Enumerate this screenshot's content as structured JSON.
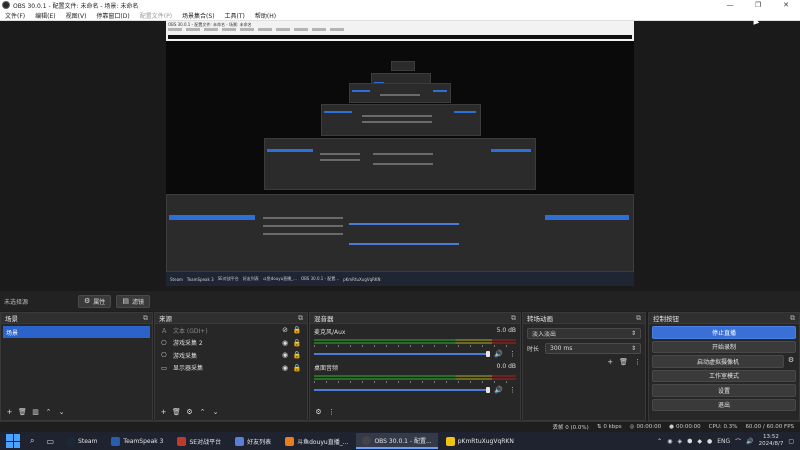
{
  "window": {
    "title": "OBS 30.0.1 - 配置文件: 未命名 - 场景: 未命名",
    "buttons": [
      "—",
      "❐",
      "✕"
    ]
  },
  "menubar": {
    "items": [
      {
        "label": "文件(F)",
        "disabled": false
      },
      {
        "label": "编辑(E)",
        "disabled": false
      },
      {
        "label": "视图(V)",
        "disabled": false
      },
      {
        "label": "停靠窗口(D)",
        "disabled": false
      },
      {
        "label": "配置文件(P)",
        "disabled": true
      },
      {
        "label": "场景集合(S)",
        "disabled": false
      },
      {
        "label": "工具(T)",
        "disabled": false
      },
      {
        "label": "帮助(H)",
        "disabled": false
      }
    ]
  },
  "source_toolbar": {
    "label": "未选择源",
    "properties_label": "属性",
    "filters_label": "滤镜"
  },
  "scenes": {
    "title": "场景",
    "items": [
      "场景"
    ]
  },
  "sources": {
    "title": "来源",
    "items": [
      {
        "name": "文本 (GDI+)",
        "icon": "text-icon",
        "visible": false
      },
      {
        "name": "游戏采集 2",
        "icon": "gamepad-icon",
        "visible": true
      },
      {
        "name": "游戏采集",
        "icon": "gamepad-icon",
        "visible": true
      },
      {
        "name": "显示器采集",
        "icon": "monitor-icon",
        "visible": true
      }
    ]
  },
  "mixer": {
    "title": "混音器",
    "channels": [
      {
        "name": "麦克风/Aux",
        "db": "5.0 dB"
      },
      {
        "name": "桌面音频",
        "db": "0.0 dB"
      }
    ]
  },
  "transitions": {
    "title": "转场动画",
    "selected": "淡入淡出",
    "duration_label": "时长",
    "duration_value": "300 ms"
  },
  "controls": {
    "title": "控制按钮",
    "buttons": [
      {
        "label": "停止直播",
        "active": true
      },
      {
        "label": "开始录制",
        "active": false
      },
      {
        "label": "启动虚拟摄像机",
        "active": false
      },
      {
        "label": "工作室模式",
        "active": false
      },
      {
        "label": "设置",
        "active": false
      },
      {
        "label": "退出",
        "active": false
      }
    ]
  },
  "status": {
    "dropped": "丢帧 0 (0.0%)",
    "kbps": "0 kbps",
    "stream_time": "00:00:00",
    "rec_time": "00:00:00",
    "cpu": "CPU: 0.3%",
    "fps": "60.00 / 60.00 FPS"
  },
  "taskbar": {
    "apps": [
      {
        "label": "Steam",
        "color": "#1b2838",
        "active": false
      },
      {
        "label": "TeamSpeak 3",
        "color": "#2a5db0",
        "active": false
      },
      {
        "label": "SE对战平台",
        "color": "#c0392b",
        "active": false
      },
      {
        "label": "好友列表",
        "color": "#5b7fd6",
        "active": false
      },
      {
        "label": "斗鱼douyu直播_...",
        "color": "#e67e22",
        "active": false
      },
      {
        "label": "OBS 30.0.1 - 配置...",
        "color": "#444444",
        "active": true
      },
      {
        "label": "pKmRtuXugVqRKN",
        "color": "#f1c40f",
        "active": false
      }
    ],
    "tray": {
      "lang": "ENG",
      "time": "13:52",
      "date": "2024/8/7"
    }
  },
  "preview": {
    "title": "OBS 30.0.1 - 配置文件: 未命名 - 场景: 未命名",
    "taskbar_labels": [
      "Steam",
      "TeamSpeak 3",
      "SE对战平台",
      "好友列表",
      "斗鱼douyu直播_...",
      "OBS 30.0.1 - 配置...",
      "pKmRtuXugVqRKN"
    ]
  },
  "colors": {
    "accent": "#3a6fd6",
    "panel": "#272727",
    "background": "#1e1e1e"
  }
}
